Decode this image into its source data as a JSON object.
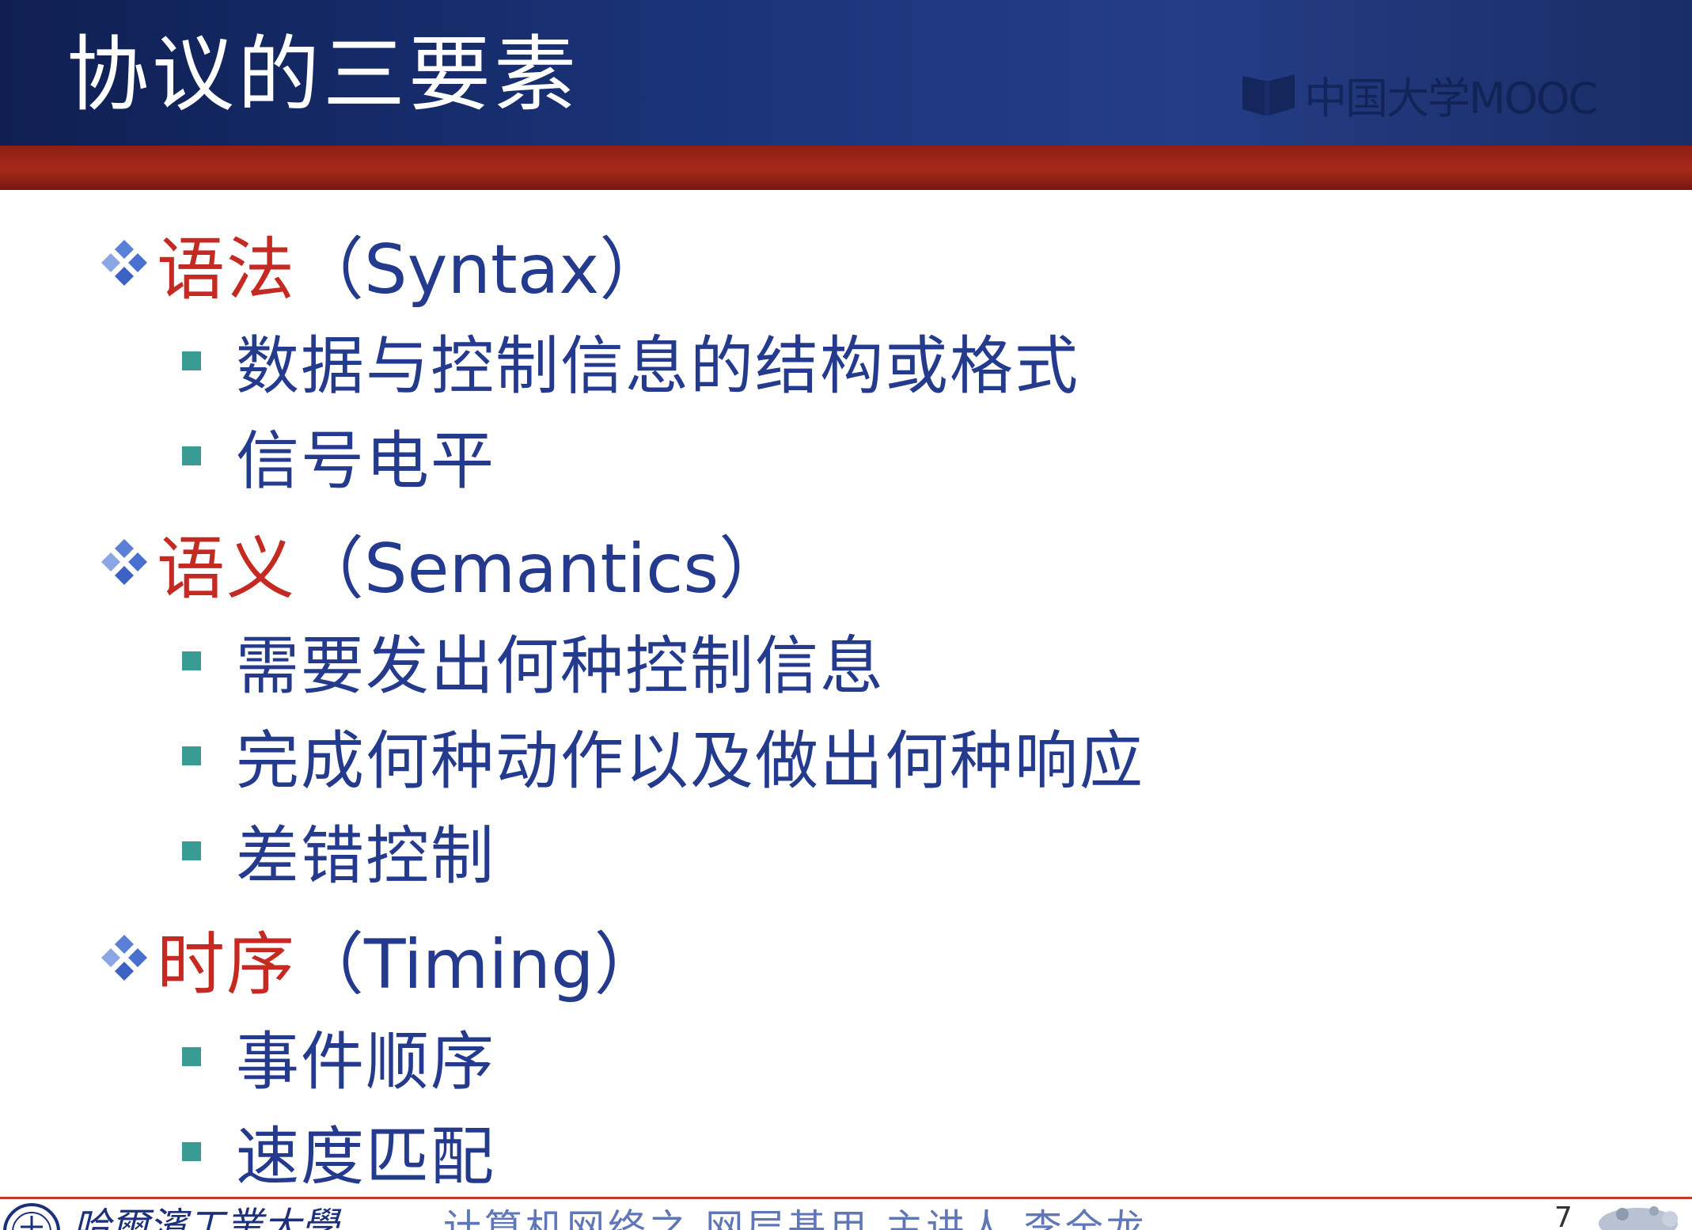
{
  "slide": {
    "title": "协议的三要素",
    "watermark": "中国大学MOOC"
  },
  "items": [
    {
      "cn": "语法",
      "en": "（Syntax）",
      "sub": [
        "数据与控制信息的结构或格式",
        "信号电平"
      ]
    },
    {
      "cn": "语义",
      "en": "（Semantics）",
      "sub": [
        "需要发出何种控制信息",
        "完成何种动作以及做出何种响应",
        "差错控制"
      ]
    },
    {
      "cn": "时序",
      "en": "（Timing）",
      "sub": [
        "事件顺序",
        "速度匹配"
      ]
    }
  ],
  "footer": {
    "university": "哈爾濱工業大學",
    "course": "计算机网络之 网层基用   主讲人   李全龙",
    "page": "7"
  },
  "colors": {
    "header_blue": "#1a3378",
    "accent_red": "#c42a22",
    "text_blue": "#243a8c",
    "bullet_teal": "#3a9a94",
    "diamond_blue": "#5a7fd6"
  },
  "icons": {
    "level1_bullet": "diamond-cluster-icon",
    "level2_bullet": "square-bullet-icon",
    "watermark_logo": "mooc-book-icon",
    "footer_logo": "university-seal-icon"
  }
}
